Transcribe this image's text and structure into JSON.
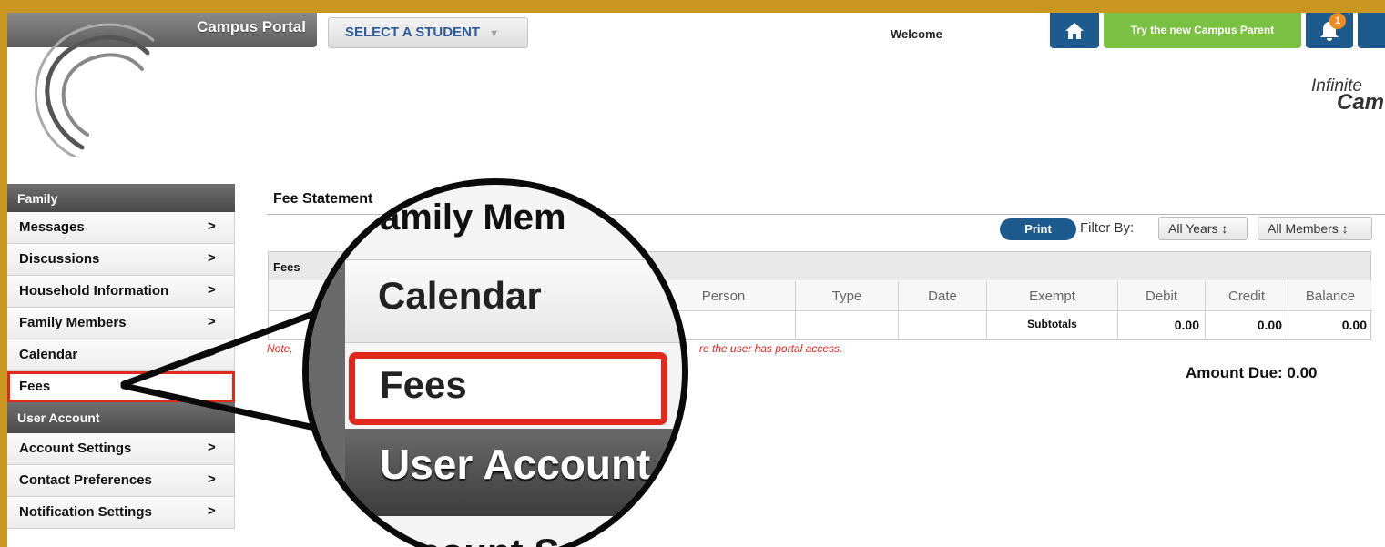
{
  "header": {
    "portal_title": "Campus Portal",
    "student_select": "SELECT A STUDENT",
    "welcome": "Welcome",
    "try_new": "Try the new Campus Parent",
    "notification_count": "1",
    "brand_line1": "Infinite",
    "brand_line2": "Cam"
  },
  "sidebar": {
    "section_family": "Family",
    "family_items": [
      {
        "label": "Messages",
        "chevron": ">"
      },
      {
        "label": "Discussions",
        "chevron": ">"
      },
      {
        "label": "Household Information",
        "chevron": ">"
      },
      {
        "label": "Family Members",
        "chevron": ">"
      },
      {
        "label": "Calendar",
        "chevron": ">"
      },
      {
        "label": "Fees",
        "chevron": ""
      }
    ],
    "section_user": "User Account",
    "user_items": [
      {
        "label": "Account Settings",
        "chevron": ">"
      },
      {
        "label": "Contact Preferences",
        "chevron": ">"
      },
      {
        "label": "Notification Settings",
        "chevron": ">"
      }
    ]
  },
  "main": {
    "title": "Fee Statement",
    "print": "Print",
    "filter_label": "Filter By:",
    "filter_years": "All Years ↕",
    "filter_members": "All Members ↕",
    "fees_header": "Fees",
    "columns": [
      "Person",
      "Type",
      "Date",
      "Exempt",
      "Debit",
      "Credit",
      "Balance"
    ],
    "subtotals_label": "Subtotals",
    "subtotals": [
      "0.00",
      "0.00",
      "0.00"
    ],
    "note_start": "Note,",
    "note_end": "re the user has portal access.",
    "amount_due": "Amount Due: 0.00"
  },
  "callout": {
    "family_text": "amily Mem",
    "calendar_text": "Calendar",
    "fees_text": "Fees",
    "user_account_text": "User Account",
    "account_text": "ccount S"
  },
  "colors": {
    "frame": "#c9961f",
    "nav_blue": "#1d5b8f",
    "green": "#7ac143",
    "highlight_red": "#e0281b"
  }
}
